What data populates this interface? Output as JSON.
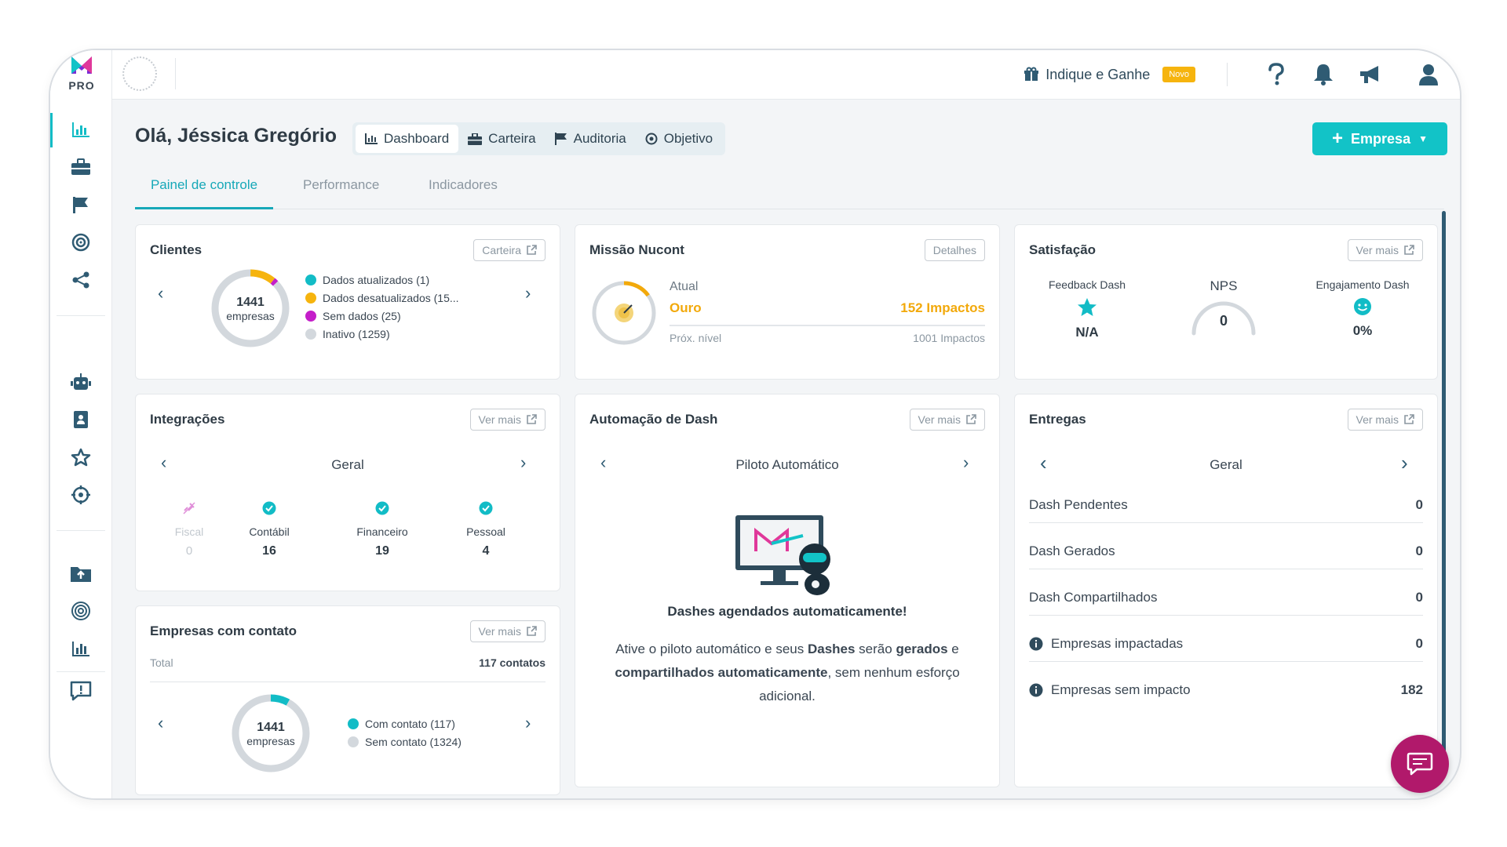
{
  "logo": {
    "text": "PRO"
  },
  "topbar": {
    "indique_label": "Indique e Ganhe",
    "novo_badge": "Novo"
  },
  "greeting": "Olá, Jéssica Gregório",
  "nav": [
    {
      "label": "Dashboard",
      "icon": "chart-icon"
    },
    {
      "label": "Carteira",
      "icon": "briefcase-icon"
    },
    {
      "label": "Auditoria",
      "icon": "flag-icon"
    },
    {
      "label": "Objetivo",
      "icon": "target-icon"
    }
  ],
  "empresa_button": "Empresa",
  "tabs": [
    "Painel de controle",
    "Performance",
    "Indicadores"
  ],
  "clientes": {
    "title": "Clientes",
    "button": "Carteira",
    "total": "1441",
    "unit": "empresas",
    "legend": [
      {
        "label": "Dados atualizados (1)",
        "color": "#12bcc6",
        "value": 1
      },
      {
        "label": "Dados desatualizados (15...",
        "color": "#f6b40e",
        "value": 156
      },
      {
        "label": "Sem dados (25)",
        "color": "#c41ec9",
        "value": 25
      },
      {
        "label": "Inativo (1259)",
        "color": "#d3d8dd",
        "value": 1259
      }
    ]
  },
  "missao": {
    "title": "Missão Nucont",
    "button": "Detalhes",
    "atual_label": "Atual",
    "level": "Ouro",
    "impacts": "152 Impactos",
    "next_label": "Próx. nível",
    "next_impacts": "1001 Impactos",
    "progress": 0.15
  },
  "satisfacao": {
    "title": "Satisfação",
    "button": "Ver mais",
    "feedback_label": "Feedback Dash",
    "feedback_value": "N/A",
    "nps_label": "NPS",
    "nps_value": "0",
    "engajamento_label": "Engajamento Dash",
    "engajamento_value": "0%"
  },
  "integracoes": {
    "title": "Integrações",
    "button": "Ver mais",
    "selector": "Geral",
    "items": [
      {
        "label": "Fiscal",
        "value": "0",
        "status": "disabled"
      },
      {
        "label": "Contábil",
        "value": "16",
        "status": "ok"
      },
      {
        "label": "Financeiro",
        "value": "19",
        "status": "ok"
      },
      {
        "label": "Pessoal",
        "value": "4",
        "status": "ok"
      }
    ]
  },
  "automacao": {
    "title": "Automação de Dash",
    "button": "Ver mais",
    "selector": "Piloto Automático",
    "headline": "Dashes agendados automaticamente!",
    "desc_1": "Ative o piloto automático e seus ",
    "desc_bold_1": "Dashes",
    "desc_2": " serão ",
    "desc_bold_2": "gerados",
    "desc_3": " e",
    "desc_bold_3": "compartilhados automaticamente",
    "desc_4": ", sem nenhum esforço",
    "desc_5": "adicional."
  },
  "entregas": {
    "title": "Entregas",
    "button": "Ver mais",
    "selector": "Geral",
    "rows": [
      {
        "label": "Dash Pendentes",
        "value": "0"
      },
      {
        "label": "Dash Gerados",
        "value": "0"
      },
      {
        "label": "Dash Compartilhados",
        "value": "0"
      },
      {
        "label": "Empresas impactadas",
        "value": "0"
      },
      {
        "label": "Empresas sem impacto",
        "value": "182"
      }
    ]
  },
  "contato": {
    "title": "Empresas com contato",
    "button": "Ver mais",
    "total_label": "Total",
    "total_value": "117 contatos",
    "donut_total": "1441",
    "unit": "empresas",
    "legend": [
      {
        "label": "Com contato (117)",
        "color": "#12bcc6",
        "value": 117
      },
      {
        "label": "Sem contato (1324)",
        "color": "#d3d8dd",
        "value": 1324
      }
    ]
  }
}
